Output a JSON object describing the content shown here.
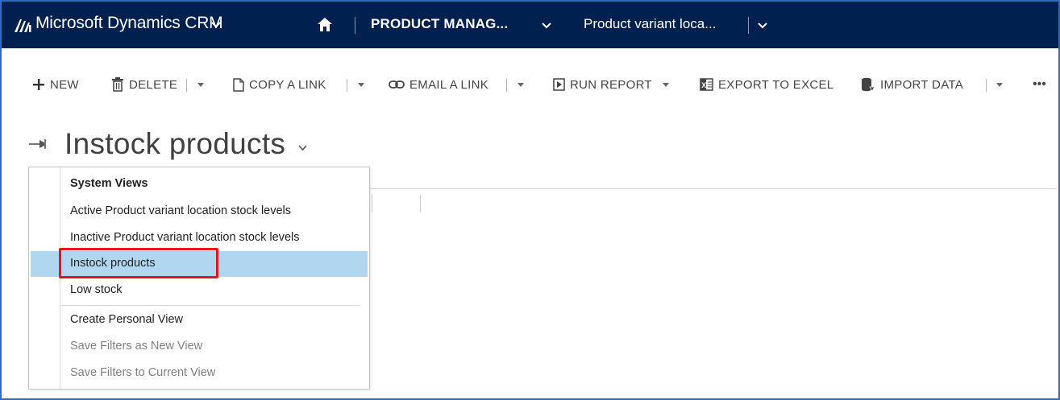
{
  "header": {
    "app_title": "Microsoft Dynamics CRM",
    "area": "PRODUCT MANAG...",
    "entity": "Product variant loca..."
  },
  "toolbar": {
    "new": "NEW",
    "delete": "DELETE",
    "copy_link": "COPY A LINK",
    "email_link": "EMAIL A LINK",
    "run_report": "RUN REPORT",
    "export_excel": "EXPORT TO EXCEL",
    "import_data": "IMPORT DATA",
    "more": "•••"
  },
  "view": {
    "title": "Instock products"
  },
  "view_menu": {
    "heading": "System Views",
    "items": [
      {
        "label": "Active Product variant location stock levels"
      },
      {
        "label": "Inactive Product variant location stock levels"
      },
      {
        "label": "Instock products"
      },
      {
        "label": "Low stock"
      }
    ],
    "actions": [
      {
        "label": "Create Personal View"
      },
      {
        "label": "Save Filters as New View"
      },
      {
        "label": "Save Filters to Current View"
      }
    ]
  },
  "colors": {
    "nav_background": "#002050",
    "selected_item": "#b1d6f0",
    "highlight_border": "#e8141c",
    "frame_border": "#2b6cc4"
  }
}
